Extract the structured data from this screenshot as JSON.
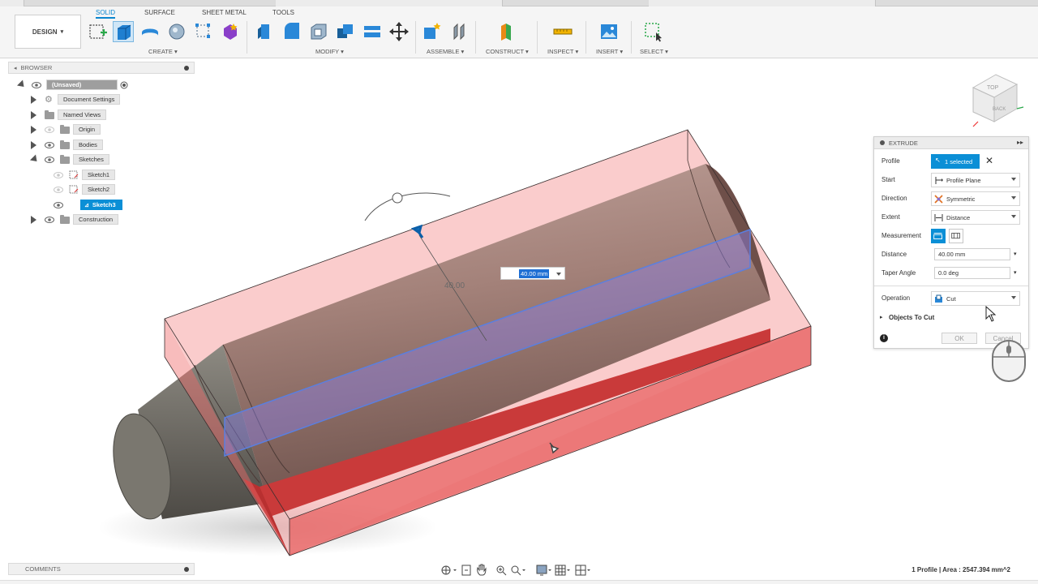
{
  "toolbar": {
    "design_label": "DESIGN",
    "tabs": [
      "SOLID",
      "SURFACE",
      "SHEET METAL",
      "TOOLS"
    ],
    "groups": [
      "CREATE",
      "MODIFY",
      "ASSEMBLE",
      "CONSTRUCT",
      "INSPECT",
      "INSERT",
      "SELECT"
    ]
  },
  "browser": {
    "title": "BROWSER",
    "root": "(Unsaved)",
    "items": [
      "Document Settings",
      "Named Views",
      "Origin",
      "Bodies",
      "Sketches",
      "Construction"
    ],
    "sketches": [
      "Sketch1",
      "Sketch2",
      "Sketch3"
    ]
  },
  "viewcube": {
    "faces": [
      "TOP",
      "BACK"
    ]
  },
  "viewport": {
    "dimension_label": "40.00",
    "dimension_input": "40.00 mm"
  },
  "extrude": {
    "title": "EXTRUDE",
    "rows": {
      "profile": {
        "label": "Profile",
        "value": "1 selected"
      },
      "start": {
        "label": "Start",
        "value": "Profile Plane"
      },
      "direction": {
        "label": "Direction",
        "value": "Symmetric"
      },
      "extent": {
        "label": "Extent",
        "value": "Distance"
      },
      "measurement": {
        "label": "Measurement"
      },
      "distance": {
        "label": "Distance",
        "value": "40.00 mm"
      },
      "taper": {
        "label": "Taper Angle",
        "value": "0.0 deg"
      },
      "operation": {
        "label": "Operation",
        "value": "Cut"
      }
    },
    "objects_to_cut": "Objects To Cut",
    "ok": "OK",
    "cancel": "Cancel"
  },
  "comments": {
    "title": "COMMENTS"
  },
  "status": "1 Profile | Area : 2547.394 mm^2",
  "colors": {
    "accent": "#0b8fd6",
    "cut_body": "#f26d6d",
    "shaft": "#9e7a72",
    "selection": "#7f7fe0"
  }
}
